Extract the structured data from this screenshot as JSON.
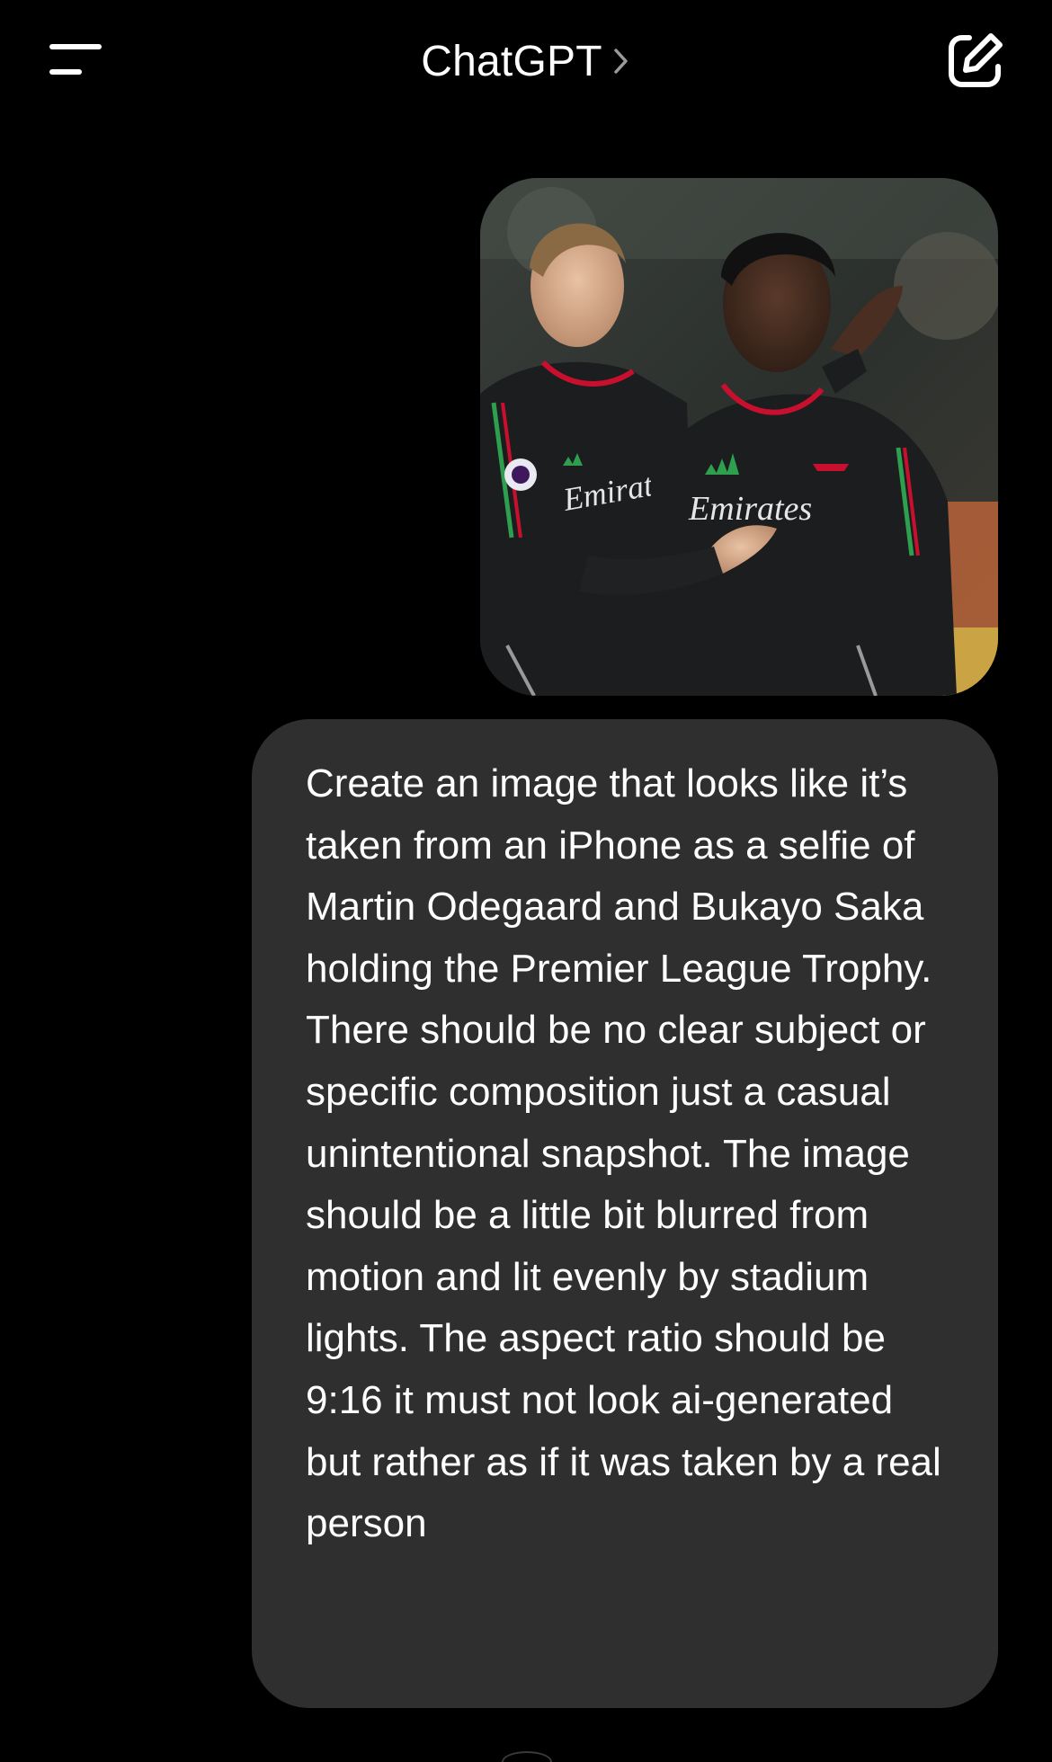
{
  "header": {
    "title": "ChatGPT",
    "menu_icon": "hamburger-menu-icon",
    "chevron_icon": "chevron-right-icon",
    "new_chat_icon": "compose-icon"
  },
  "conversation": {
    "attached_image": {
      "jersey_text_left": "Emirates",
      "jersey_text_right": "Emirates"
    },
    "user_message": "Create an image that looks like it’s taken from an iPhone as a selfie of Martin Odegaard and Bukayo Saka holding the Premier League Trophy. There should be no clear subject or specific composition just a casual unintentional snapshot. The image should be a little bit blurred from motion and lit evenly by stadium lights. The aspect ratio should be 9:16 it must not look ai-generated but rather as if it was taken by a real person"
  },
  "colors": {
    "background": "#000000",
    "bubble": "#2f2f2f",
    "text": "#ffffff",
    "jersey": "#1b1d1e",
    "jersey_accent_red": "#c8102e",
    "jersey_accent_green": "#2e9e4f"
  }
}
